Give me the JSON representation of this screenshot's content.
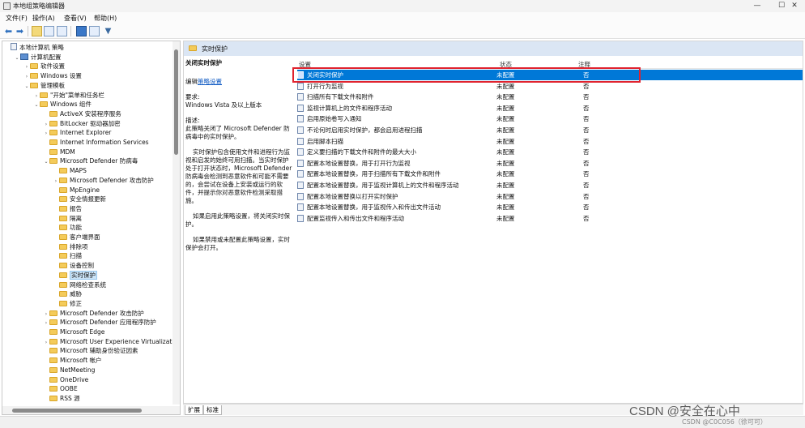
{
  "window": {
    "title": "本地组策略编辑器",
    "min_glyph": "—",
    "max_glyph": "☐",
    "close_glyph": "✕"
  },
  "menu": [
    "文件(F)",
    "操作(A)",
    "查看(V)",
    "帮助(H)"
  ],
  "toolbar": {
    "back_glyph": "⬅",
    "forward_glyph": "➡"
  },
  "tree": [
    {
      "label": "本地计算机 策略",
      "depth": 0,
      "toggle": "",
      "icon": "doc"
    },
    {
      "label": "计算机配置",
      "depth": 1,
      "toggle": "⌄",
      "icon": "pc"
    },
    {
      "label": "软件设置",
      "depth": 2,
      "toggle": "›",
      "icon": "folder"
    },
    {
      "label": "Windows 设置",
      "depth": 2,
      "toggle": "›",
      "icon": "folder"
    },
    {
      "label": "管理模板",
      "depth": 2,
      "toggle": "⌄",
      "icon": "folder"
    },
    {
      "label": "\"开始\"菜单和任务栏",
      "depth": 3,
      "toggle": "›",
      "icon": "folder"
    },
    {
      "label": "Windows 组件",
      "depth": 3,
      "toggle": "⌄",
      "icon": "folder"
    },
    {
      "label": "ActiveX 安装程序服务",
      "depth": 4,
      "toggle": "",
      "icon": "folder"
    },
    {
      "label": "BitLocker 驱动器加密",
      "depth": 4,
      "toggle": "›",
      "icon": "folder"
    },
    {
      "label": "Internet Explorer",
      "depth": 4,
      "toggle": "›",
      "icon": "folder"
    },
    {
      "label": "Internet Information Services",
      "depth": 4,
      "toggle": "",
      "icon": "folder"
    },
    {
      "label": "MDM",
      "depth": 4,
      "toggle": "",
      "icon": "folder"
    },
    {
      "label": "Microsoft Defender 防病毒",
      "depth": 4,
      "toggle": "⌄",
      "icon": "folder"
    },
    {
      "label": "MAPS",
      "depth": 5,
      "toggle": "",
      "icon": "folder"
    },
    {
      "label": "Microsoft Defender 攻击防护",
      "depth": 5,
      "toggle": "›",
      "icon": "folder"
    },
    {
      "label": "MpEngine",
      "depth": 5,
      "toggle": "",
      "icon": "folder"
    },
    {
      "label": "安全情报更新",
      "depth": 5,
      "toggle": "",
      "icon": "folder"
    },
    {
      "label": "报告",
      "depth": 5,
      "toggle": "",
      "icon": "folder"
    },
    {
      "label": "隔离",
      "depth": 5,
      "toggle": "",
      "icon": "folder"
    },
    {
      "label": "功能",
      "depth": 5,
      "toggle": "",
      "icon": "folder"
    },
    {
      "label": "客户端界面",
      "depth": 5,
      "toggle": "",
      "icon": "folder"
    },
    {
      "label": "排除项",
      "depth": 5,
      "toggle": "",
      "icon": "folder"
    },
    {
      "label": "扫描",
      "depth": 5,
      "toggle": "",
      "icon": "folder"
    },
    {
      "label": "设备控制",
      "depth": 5,
      "toggle": "",
      "icon": "folder"
    },
    {
      "label": "实时保护",
      "depth": 5,
      "toggle": "",
      "icon": "folder",
      "selected": true
    },
    {
      "label": "网络检查系统",
      "depth": 5,
      "toggle": "",
      "icon": "folder"
    },
    {
      "label": "威胁",
      "depth": 5,
      "toggle": "",
      "icon": "folder"
    },
    {
      "label": "修正",
      "depth": 5,
      "toggle": "",
      "icon": "folder"
    },
    {
      "label": "Microsoft Defender 攻击防护",
      "depth": 4,
      "toggle": "›",
      "icon": "folder"
    },
    {
      "label": "Microsoft Defender 应用程序防护",
      "depth": 4,
      "toggle": "›",
      "icon": "folder"
    },
    {
      "label": "Microsoft Edge",
      "depth": 4,
      "toggle": "",
      "icon": "folder"
    },
    {
      "label": "Microsoft User Experience Virtualization",
      "depth": 4,
      "toggle": "›",
      "icon": "folder"
    },
    {
      "label": "Microsoft 辅助身份验证因素",
      "depth": 4,
      "toggle": "",
      "icon": "folder"
    },
    {
      "label": "Microsoft 帐户",
      "depth": 4,
      "toggle": "",
      "icon": "folder"
    },
    {
      "label": "NetMeeting",
      "depth": 4,
      "toggle": "",
      "icon": "folder"
    },
    {
      "label": "OneDrive",
      "depth": 4,
      "toggle": "",
      "icon": "folder"
    },
    {
      "label": "OOBE",
      "depth": 4,
      "toggle": "",
      "icon": "folder"
    },
    {
      "label": "RSS 源",
      "depth": 4,
      "toggle": "",
      "icon": "folder"
    }
  ],
  "right_pane": {
    "header_title": "实时保护",
    "description": {
      "setting_name": "关闭实时保护",
      "edit_prefix": "编辑",
      "edit_link": "策略设置",
      "requirements_label": "要求:",
      "requirements": "Windows Vista 及以上版本",
      "desc_label": "描述:",
      "desc_p1": "此策略关闭了 Microsoft Defender 防病毒中的实时保护。",
      "desc_p2": "实时保护包含使用文件和进程行为监视和启发的始终可用扫描。当实时保护处于打开状态时，Microsoft Defender 防病毒会检测到恶意软件和可能不需要的，会尝试在设备上安装或运行的软件，并提示你对恶意软件检测采取措施。",
      "desc_p3": "如果启用此策略设置，将关闭实时保护。",
      "desc_p4": "如果禁用或未配置此策略设置，实时保护会打开。"
    },
    "columns": {
      "setting": "设置",
      "state": "状态",
      "note": "注释"
    },
    "rows": [
      {
        "name": "关闭实时保护",
        "state": "未配置",
        "note": "否",
        "selected": true
      },
      {
        "name": "打开行为监视",
        "state": "未配置",
        "note": "否"
      },
      {
        "name": "扫描所有下载文件和附件",
        "state": "未配置",
        "note": "否"
      },
      {
        "name": "监视计算机上的文件和程序活动",
        "state": "未配置",
        "note": "否"
      },
      {
        "name": "启用原始卷写入通知",
        "state": "未配置",
        "note": "否"
      },
      {
        "name": "不论何时启用实时保护，都会启用进程扫描",
        "state": "未配置",
        "note": "否"
      },
      {
        "name": "启用脚本扫描",
        "state": "未配置",
        "note": "否"
      },
      {
        "name": "定义要扫描的下载文件和附件的最大大小",
        "state": "未配置",
        "note": "否"
      },
      {
        "name": "配置本地设置替换，用于打开行为监视",
        "state": "未配置",
        "note": "否"
      },
      {
        "name": "配置本地设置替换，用于扫描所有下载文件和附件",
        "state": "未配置",
        "note": "否"
      },
      {
        "name": "配置本地设置替换，用于监视计算机上的文件和程序活动",
        "state": "未配置",
        "note": "否"
      },
      {
        "name": "配置本地设置替换以打开实时保护",
        "state": "未配置",
        "note": "否"
      },
      {
        "name": "配置本地设置替换，用于监视传入和传出文件活动",
        "state": "未配置",
        "note": "否"
      },
      {
        "name": "配置监视传入和传出文件和程序活动",
        "state": "未配置",
        "note": "否"
      }
    ]
  },
  "tabs": [
    "扩展",
    "标准"
  ],
  "watermark": "CSDN @安全在心中",
  "watermark_small": "CSDN @C0C056（徐可可）",
  "colors": {
    "selection": "#0078d7",
    "highlight_border": "#e0232e",
    "header_band": "#dbe6f4",
    "folder": "#f4cb5a"
  }
}
